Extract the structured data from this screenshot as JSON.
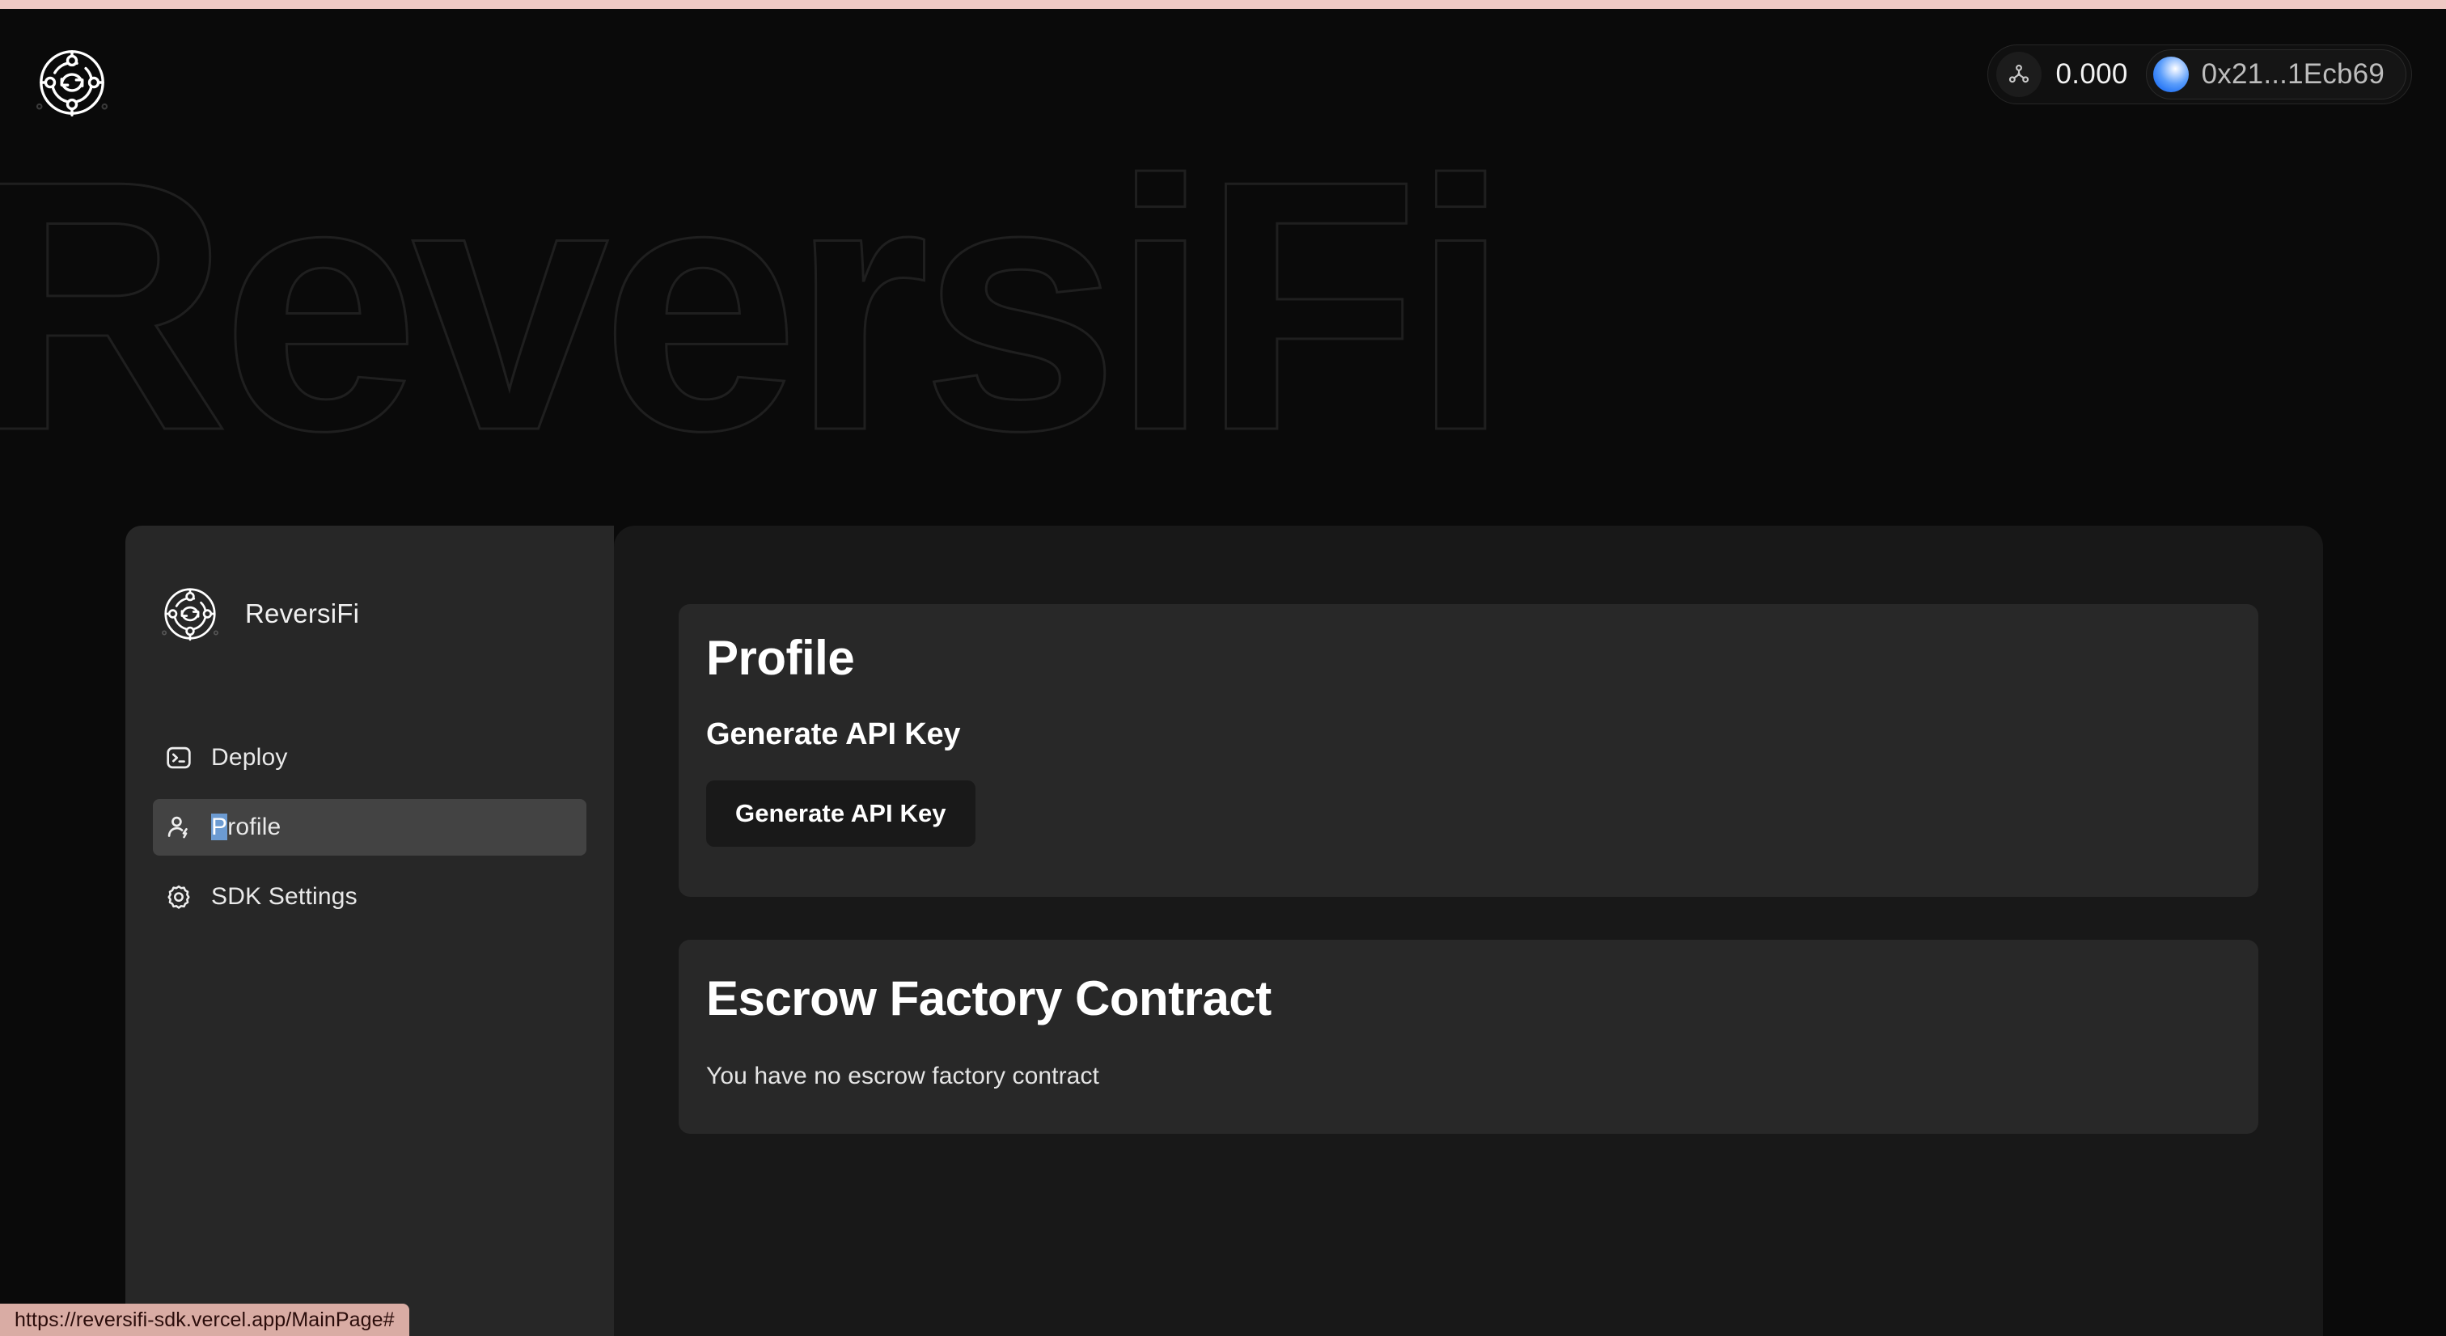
{
  "browser": {
    "status_bar_url": "https://reversifi-sdk.vercel.app/MainPage#"
  },
  "header": {
    "logo_icon": "reversifi-logo-icon",
    "wallet": {
      "network_icon": "network-nodes-icon",
      "balance": "0.000",
      "avatar_icon": "wallet-avatar-icon",
      "address": "0x21...1Ecb69"
    }
  },
  "background": {
    "watermark_text": "ReversiFi"
  },
  "sidebar": {
    "logo_icon": "reversifi-logo-icon",
    "brand_name": "ReversiFi",
    "items": [
      {
        "label": "Deploy",
        "icon": "terminal-icon",
        "active": false
      },
      {
        "label": "Profile",
        "icon": "user-bolt-icon",
        "active": true,
        "selected_prefix": "P",
        "rest": "rofile"
      },
      {
        "label": "SDK Settings",
        "icon": "gear-icon",
        "active": false
      }
    ]
  },
  "main": {
    "profile_card": {
      "title": "Profile",
      "subtitle": "Generate API Key",
      "button_label": "Generate API Key"
    },
    "escrow_card": {
      "title": "Escrow Factory Contract",
      "empty_text": "You have no escrow factory contract"
    }
  },
  "colors": {
    "page_background": "#0a0a0a",
    "sidebar_background": "#272727",
    "main_panel_background": "#181818",
    "card_background": "#282828",
    "active_nav_background": "#434343",
    "text_selection_blue": "#6c9bd2",
    "status_bar_background": "#d9aca4",
    "accent_blue": "#2f7cf6"
  }
}
